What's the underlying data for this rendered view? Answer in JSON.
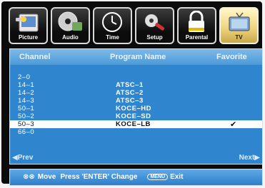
{
  "tabs": [
    {
      "label": "Picture",
      "icon": "picture-icon",
      "active": false
    },
    {
      "label": "Audio",
      "icon": "audio-cd-icon",
      "active": false
    },
    {
      "label": "Time",
      "icon": "clock-icon",
      "active": false
    },
    {
      "label": "Setup",
      "icon": "gear-setup-icon",
      "active": false
    },
    {
      "label": "Parental",
      "icon": "lock-icon",
      "active": false
    },
    {
      "label": "TV",
      "icon": "tv-antenna-icon",
      "active": true
    }
  ],
  "table": {
    "headers": {
      "channel": "Channel",
      "program": "Program Name",
      "favorite": "Favorite"
    },
    "rows": [
      {
        "channel": "2–0",
        "program": "",
        "favorite": false
      },
      {
        "channel": "14–1",
        "program": "ATSC–1",
        "favorite": false
      },
      {
        "channel": "14–2",
        "program": "ATSC–2",
        "favorite": false
      },
      {
        "channel": "14–3",
        "program": "ATSC–3",
        "favorite": false
      },
      {
        "channel": "50–1",
        "program": "KOCE–HD",
        "favorite": false
      },
      {
        "channel": "50–2",
        "program": "KOCE–SD",
        "favorite": false
      },
      {
        "channel": "50–3",
        "program": "KOCE–LB",
        "favorite": true,
        "selected": true
      },
      {
        "channel": "66–0",
        "program": "",
        "favorite": false
      }
    ],
    "favorite_mark": "✔"
  },
  "nav": {
    "prev": "◀Prev",
    "next": "Next▶"
  },
  "footer": {
    "move_arrows": "⊗⊗",
    "move": "Move",
    "change": "Press 'ENTER' Change",
    "menu_key": "MENU",
    "exit": "Exit"
  },
  "colors": {
    "panel": "#2f86cf",
    "header": "#6aaee6",
    "active_tab": "#f0d780",
    "selection": "#ffffff"
  }
}
